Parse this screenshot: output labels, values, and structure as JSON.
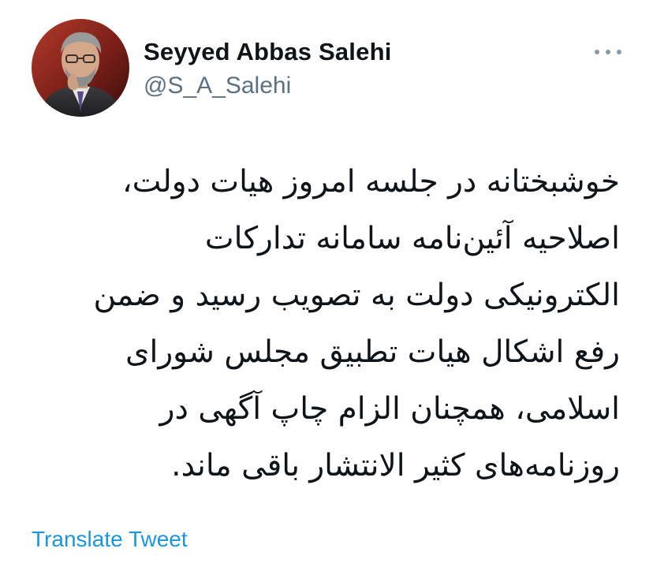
{
  "tweet": {
    "author": {
      "display_name": "Seyyed Abbas Salehi",
      "handle": "@S_A_Salehi",
      "avatar_icon": "profile-photo"
    },
    "more_icon": "more-horizontal-icon",
    "text": "خوشبختانه  در جلسه امروز هیات دولت،\nاصلاحیه آئین‌نامه سامانه تدارکات\nالکترونیکی دولت به تصویب رسید و ضمن\nرفع اشکال هیات تطبیق مجلس شورای\nاسلامی، همچنان  الزام چاپ آگهی در\nروزنامه‌های کثیر الانتشار باقی ماند.",
    "translate_label": "Translate Tweet"
  },
  "colors": {
    "text_primary": "#0f1419",
    "text_secondary": "#5b7083",
    "link": "#1b95e0",
    "icon_gray": "#8899a6",
    "background": "#ffffff"
  }
}
